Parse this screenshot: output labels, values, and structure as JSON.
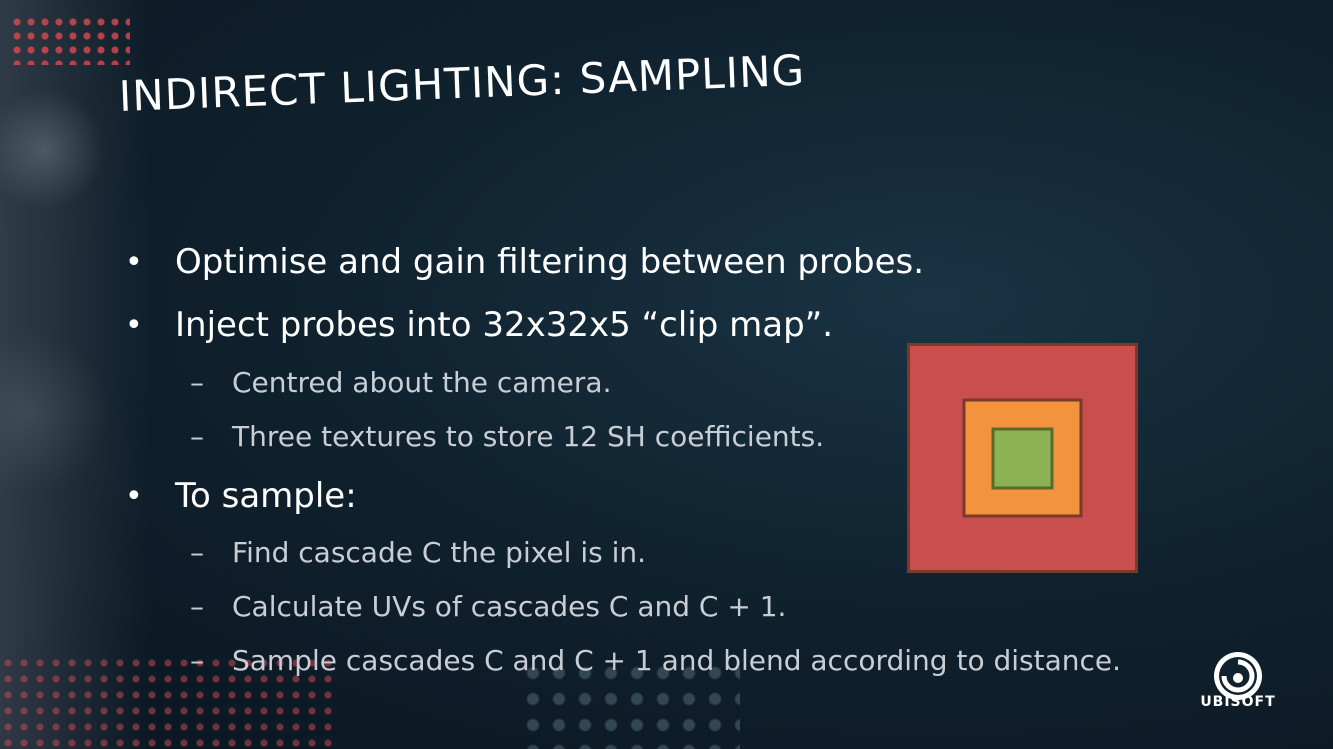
{
  "slide": {
    "title": "INDIRECT LIGHTING: SAMPLING",
    "bullets": [
      {
        "text": "Optimise and gain filtering between probes.",
        "sub": []
      },
      {
        "text": "Inject probes into 32x32x5 “clip map”.",
        "sub": [
          "Centred about the camera.",
          "Three textures to store 12 SH coefficients."
        ]
      },
      {
        "text": "To sample:",
        "sub": [
          "Find cascade C the pixel is in.",
          "Calculate UVs of cascades C and C + 1.",
          "Sample cascades C and C + 1 and blend according to distance."
        ]
      }
    ],
    "bullet_glyph": "•",
    "dash_glyph": "–"
  },
  "diagram": {
    "outer_color": "#c94f4f",
    "middle_color": "#f3933e",
    "inner_color": "#8db254",
    "border_color": "#7a3a2a"
  },
  "logo": {
    "icon": "ubisoft-swirl-icon",
    "text": "UBISOFT"
  }
}
